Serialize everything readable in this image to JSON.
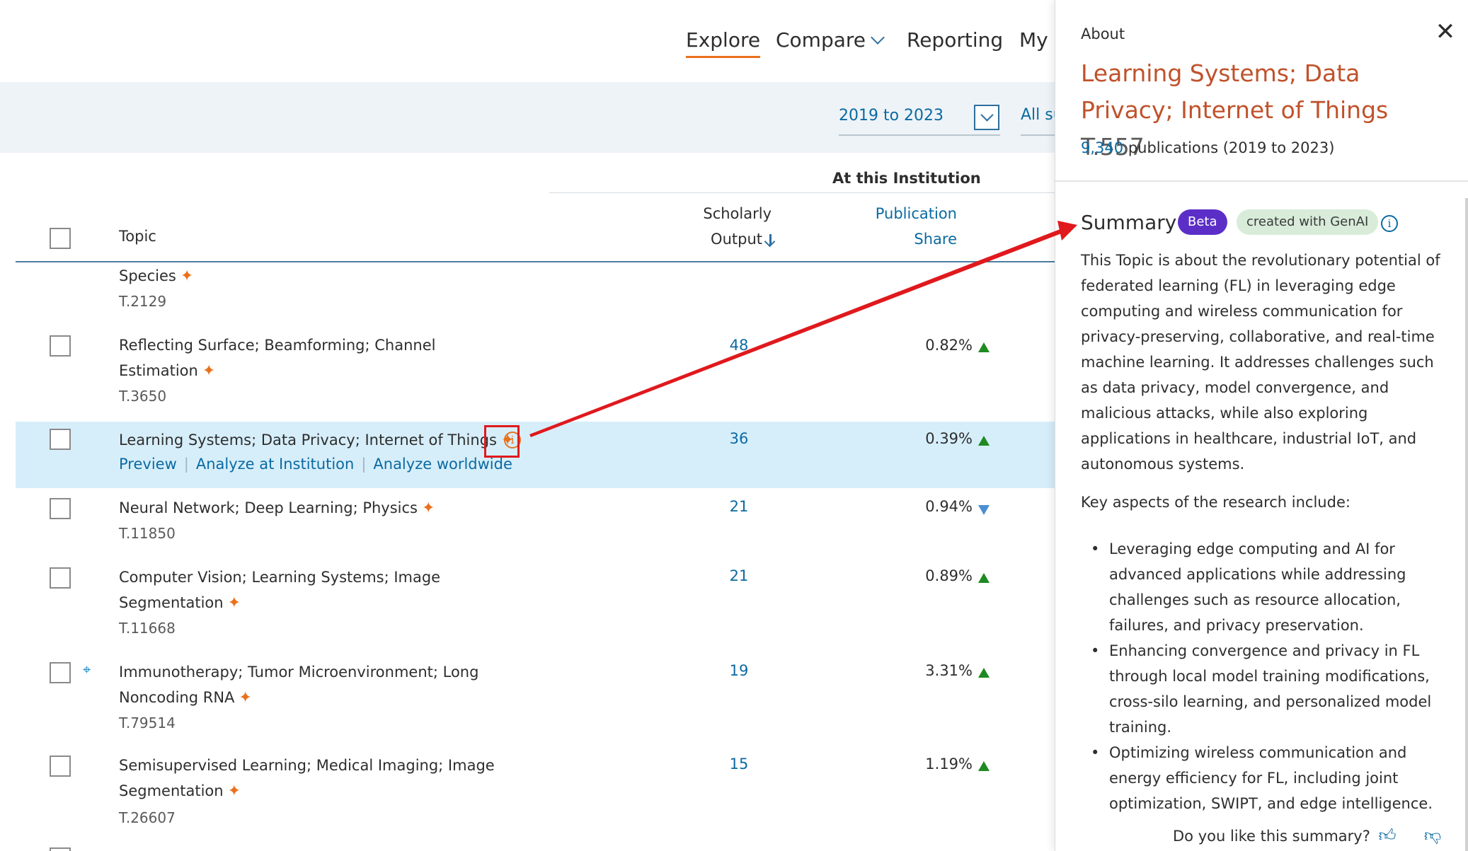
{
  "nav": {
    "explore": "Explore",
    "compare": "Compare",
    "reporting": "Reporting",
    "my": "My S"
  },
  "filters": {
    "year_range": "2019 to 2023",
    "all_subjects": "All subject areas"
  },
  "table": {
    "group_header": "At this Institution",
    "col_topic": "Topic",
    "col_scholarly_line1": "Scholarly",
    "col_scholarly_line2": "Output",
    "col_share_line1": "Publication",
    "col_share_line2": "Share",
    "rows": [
      {
        "topic_line1": "Species",
        "topic_line2": "",
        "code": "T.2129",
        "output": "",
        "share": "",
        "trend": ""
      },
      {
        "topic_line1": "Reflecting Surface; Beamforming; Channel",
        "topic_line2": "Estimation",
        "code": "T.3650",
        "output": "48",
        "share": "0.82%",
        "trend": "up"
      },
      {
        "topic_line1": "Learning Systems; Data Privacy; Internet of Things",
        "topic_line2": "",
        "code": "",
        "output": "36",
        "share": "0.39%",
        "trend": "up"
      },
      {
        "topic_line1": "Neural Network; Deep Learning; Physics",
        "topic_line2": "",
        "code": "T.11850",
        "output": "21",
        "share": "0.94%",
        "trend": "down"
      },
      {
        "topic_line1": "Computer Vision; Learning Systems; Image",
        "topic_line2": "Segmentation",
        "code": "T.11668",
        "output": "21",
        "share": "0.89%",
        "trend": "up"
      },
      {
        "topic_line1": "Immunotherapy; Tumor Microenvironment; Long",
        "topic_line2": "Noncoding RNA",
        "code": "T.79514",
        "output": "19",
        "share": "3.31%",
        "trend": "up"
      },
      {
        "topic_line1": "Semisupervised Learning; Medical Imaging; Image",
        "topic_line2": "Segmentation",
        "code": "T.26607",
        "output": "15",
        "share": "1.19%",
        "trend": "up"
      }
    ],
    "actions": {
      "preview": "Preview",
      "analyze_institution": "Analyze at Institution",
      "analyze_worldwide": "Analyze worldwide"
    }
  },
  "panel": {
    "about": "About",
    "title": "Learning Systems; Data Privacy; Internet of Things",
    "code": "T.557",
    "pubs_count": "9,340",
    "pubs_text": "publications (2019 to 2023)",
    "summary_heading": "Summary",
    "badge_beta": "Beta",
    "badge_genai": "created with GenAI",
    "summary_text": "This Topic is about the revolutionary potential of federated learning (FL) in leveraging edge computing and wireless communication for privacy-preserving, collaborative, and real-time machine learning. It addresses challenges such as data privacy, model convergence, and malicious attacks, while also exploring applications in healthcare, industrial IoT, and autonomous systems.",
    "key_heading": "Key aspects of the research include:",
    "bullets": [
      "Leveraging edge computing and AI for advanced applications while addressing challenges such as resource allocation, failures, and privacy preservation.",
      "Enhancing convergence and privacy in FL through local model training modifications, cross-silo learning, and personalized model training.",
      "Optimizing wireless communication and energy efficiency for FL, including joint optimization, SWIPT, and edge intelligence."
    ],
    "feedback": "Do you like this summary?"
  },
  "colors": {
    "accent_orange": "#e9711c",
    "link_blue": "#0b6aa2",
    "title_red": "#c0522b",
    "highlight_row": "#d6eefa",
    "annotation_red": "#e0191d"
  },
  "icons": {
    "close": "close-icon",
    "star": "sparkle-icon",
    "info": "info-icon",
    "thumbs_up": "thumbs-up-icon",
    "thumbs_down": "thumbs-down-icon"
  }
}
